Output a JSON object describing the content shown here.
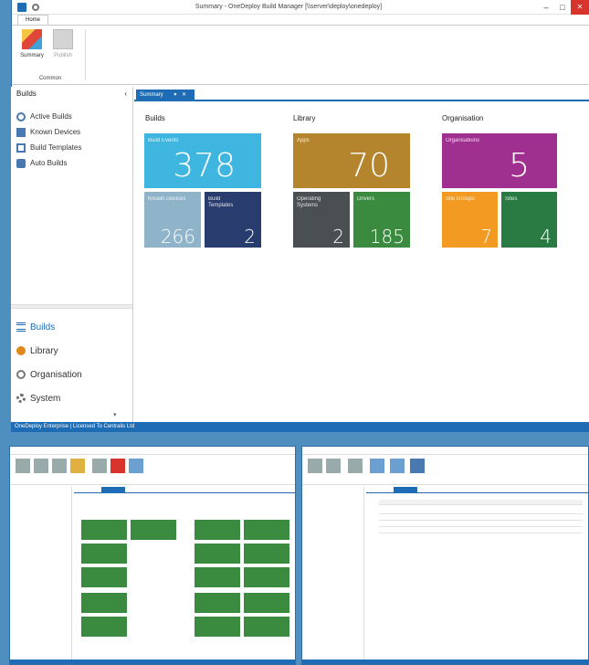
{
  "window": {
    "title": "Summary - OneDeploy Build Manager [\\\\server\\deploy\\onedeploy]",
    "minimize": "–",
    "maximize": "□",
    "close": "✕"
  },
  "ribbon": {
    "tab": "Home",
    "items": [
      {
        "label": "Summary"
      },
      {
        "label": "Publish"
      }
    ],
    "group": "Common"
  },
  "sidebar": {
    "header": "Builds",
    "collapse": "‹",
    "items": [
      {
        "label": "Active Builds",
        "icon": "active-builds-icon"
      },
      {
        "label": "Known Devices",
        "icon": "devices-icon"
      },
      {
        "label": "Build Templates",
        "icon": "template-icon"
      },
      {
        "label": "Auto Builds",
        "icon": "auto-build-icon"
      }
    ],
    "nav": [
      {
        "label": "Builds",
        "icon": "builds-nav-icon"
      },
      {
        "label": "Library",
        "icon": "library-nav-icon"
      },
      {
        "label": "Organisation",
        "icon": "organisation-nav-icon"
      },
      {
        "label": "System",
        "icon": "system-nav-icon"
      }
    ],
    "chevron": "▾"
  },
  "doc_tab": {
    "label": "Summary",
    "pin": "▾",
    "close": "✕"
  },
  "summary": {
    "builds": {
      "title": "Builds",
      "tiles": [
        {
          "label": "Build Events",
          "value": "378",
          "color": "#3fb6e0"
        },
        {
          "label": "Known Devices",
          "value": "266",
          "color": "#8fb4c9"
        },
        {
          "label": "Build Templates",
          "value": "2",
          "color": "#283c6e"
        }
      ]
    },
    "library": {
      "title": "Library",
      "tiles": [
        {
          "label": "Apps",
          "value": "70",
          "color": "#b4852c"
        },
        {
          "label": "Operating Systems",
          "value": "2",
          "color": "#4a4f52"
        },
        {
          "label": "Drivers",
          "value": "185",
          "color": "#3a8b3f"
        }
      ]
    },
    "organisation": {
      "title": "Organisation",
      "tiles": [
        {
          "label": "Organisations",
          "value": "5",
          "color": "#a03090"
        },
        {
          "label": "Site Groups",
          "value": "7",
          "color": "#f29a21"
        },
        {
          "label": "Sites",
          "value": "4",
          "color": "#2a7a43"
        }
      ]
    }
  },
  "statusbar": {
    "text": "OneDeploy Enterprise | Licensed To Centralis Ltd"
  }
}
